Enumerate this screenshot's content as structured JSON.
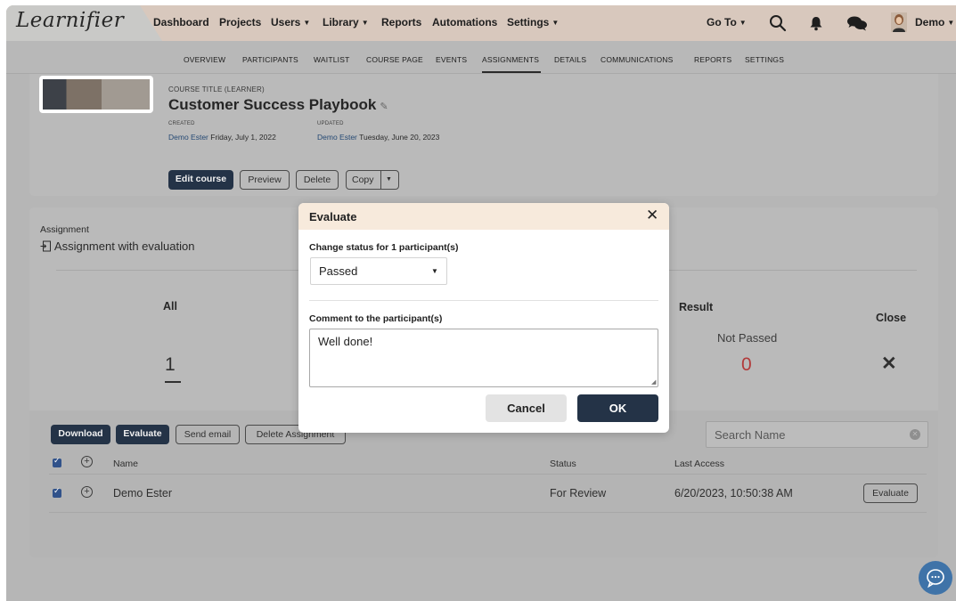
{
  "app": {
    "logo": "Learnifier"
  },
  "topnav": {
    "items": [
      "Dashboard",
      "Projects",
      "Users",
      "Library",
      "Reports",
      "Automations",
      "Settings"
    ],
    "goto": "Go To",
    "user": "Demo"
  },
  "subnav": {
    "items": [
      "OVERVIEW",
      "PARTICIPANTS",
      "WAITLIST",
      "COURSE PAGE",
      "EVENTS",
      "ASSIGNMENTS",
      "DETAILS",
      "COMMUNICATIONS",
      "REPORTS",
      "SETTINGS"
    ],
    "active": "ASSIGNMENTS"
  },
  "course": {
    "title_label": "COURSE TITLE (LEARNER)",
    "title": "Customer Success Playbook",
    "created_label": "CREATED",
    "created_by": "Demo Ester",
    "created_date": "Friday, July 1, 2022",
    "updated_label": "UPDATED",
    "updated_by": "Demo Ester",
    "updated_date": "Tuesday, June 20, 2023",
    "buttons": {
      "edit": "Edit course",
      "preview": "Preview",
      "delete": "Delete",
      "copy": "Copy"
    }
  },
  "assignment": {
    "section_label": "Assignment",
    "name": "Assignment with evaluation",
    "stats": {
      "all_label": "All",
      "all_value": "1",
      "result_label": "Result",
      "not_passed_label": "Not Passed",
      "not_passed_value": "0",
      "close_label": "Close"
    },
    "toolbar": {
      "download": "Download",
      "evaluate": "Evaluate",
      "send_email": "Send email",
      "delete": "Delete Assignment"
    },
    "search_placeholder": "Search Name",
    "table": {
      "headers": {
        "name": "Name",
        "status": "Status",
        "last_access": "Last Access"
      },
      "rows": [
        {
          "name": "Demo Ester",
          "status": "For Review",
          "last_access": "6/20/2023, 10:50:38 AM",
          "action": "Evaluate"
        }
      ]
    }
  },
  "modal": {
    "title": "Evaluate",
    "status_label": "Change status for 1 participant(s)",
    "status_value": "Passed",
    "comment_label": "Comment to the participant(s)",
    "comment_value": "Well done!",
    "cancel": "Cancel",
    "ok": "OK"
  },
  "colors": {
    "primary": "#243347",
    "accent_red": "#b23a3a",
    "nav_bg": "#d8c8bd",
    "modal_head": "#f7eadc",
    "chat": "#3f73a8"
  }
}
